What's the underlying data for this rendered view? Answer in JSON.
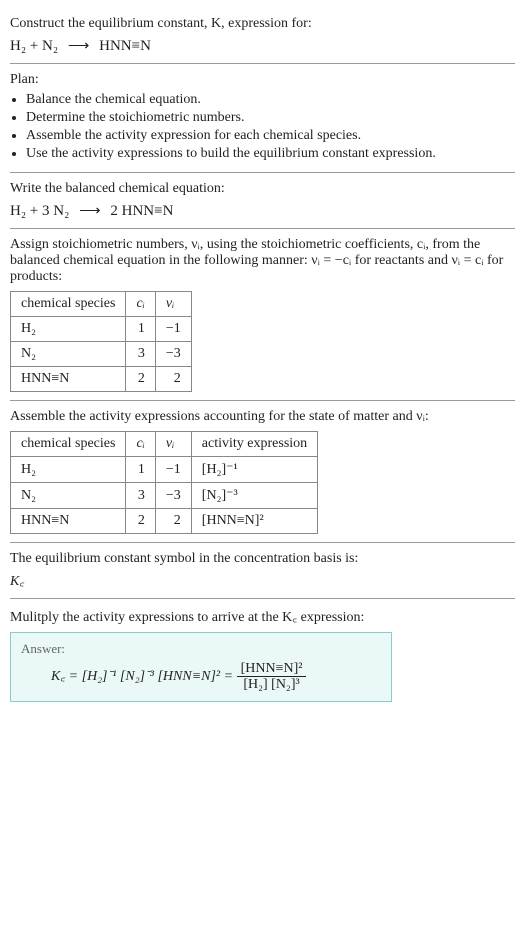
{
  "intro": {
    "line1": "Construct the equilibrium constant, K, expression for:",
    "eq_lhs": "H₂ + N₂",
    "arrow": "⟶",
    "eq_rhs": "HNN≡N"
  },
  "plan": {
    "title": "Plan:",
    "items": [
      "Balance the chemical equation.",
      "Determine the stoichiometric numbers.",
      "Assemble the activity expression for each chemical species.",
      "Use the activity expressions to build the equilibrium constant expression."
    ]
  },
  "balanced": {
    "title": "Write the balanced chemical equation:",
    "eq_lhs": "H₂ + 3 N₂",
    "arrow": "⟶",
    "eq_rhs": "2 HNN≡N"
  },
  "stoich_text": "Assign stoichiometric numbers, νᵢ, using the stoichiometric coefficients, cᵢ, from the balanced chemical equation in the following manner: νᵢ = −cᵢ for reactants and νᵢ = cᵢ for products:",
  "stoich_table": {
    "headers": [
      "chemical species",
      "cᵢ",
      "νᵢ"
    ],
    "rows": [
      [
        "H₂",
        "1",
        "−1"
      ],
      [
        "N₂",
        "3",
        "−3"
      ],
      [
        "HNN≡N",
        "2",
        "2"
      ]
    ]
  },
  "activity_text": "Assemble the activity expressions accounting for the state of matter and νᵢ:",
  "activity_table": {
    "headers": [
      "chemical species",
      "cᵢ",
      "νᵢ",
      "activity expression"
    ],
    "rows": [
      [
        "H₂",
        "1",
        "−1",
        "[H₂]⁻¹"
      ],
      [
        "N₂",
        "3",
        "−3",
        "[N₂]⁻³"
      ],
      [
        "HNN≡N",
        "2",
        "2",
        "[HNN≡N]²"
      ]
    ]
  },
  "symbol": {
    "title": "The equilibrium constant symbol in the concentration basis is:",
    "value": "K꜀"
  },
  "final": {
    "title": "Mulitply the activity expressions to arrive at the K꜀ expression:",
    "answer_label": "Answer:",
    "expr_lhs": "K꜀ = [H₂]⁻¹ [N₂]⁻³ [HNN≡N]² =",
    "frac_num": "[HNN≡N]²",
    "frac_den": "[H₂] [N₂]³"
  },
  "chart_data": {
    "type": "table",
    "tables": [
      {
        "title": "stoichiometric numbers",
        "columns": [
          "chemical species",
          "c_i",
          "nu_i"
        ],
        "rows": [
          [
            "H2",
            1,
            -1
          ],
          [
            "N2",
            3,
            -3
          ],
          [
            "HNN≡N",
            2,
            2
          ]
        ]
      },
      {
        "title": "activity expressions",
        "columns": [
          "chemical species",
          "c_i",
          "nu_i",
          "activity expression"
        ],
        "rows": [
          [
            "H2",
            1,
            -1,
            "[H2]^-1"
          ],
          [
            "N2",
            3,
            -3,
            "[N2]^-3"
          ],
          [
            "HNN≡N",
            2,
            2,
            "[HNN≡N]^2"
          ]
        ]
      }
    ]
  }
}
